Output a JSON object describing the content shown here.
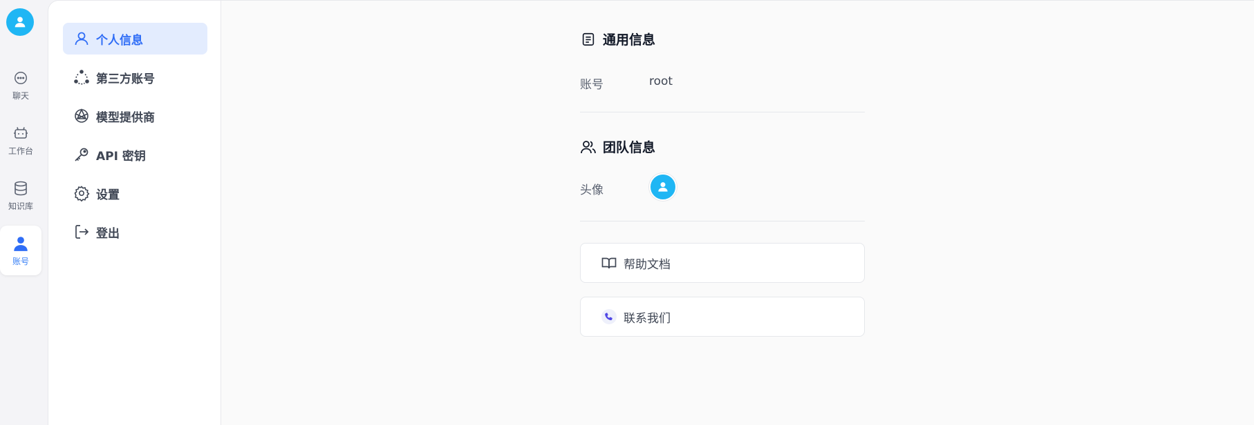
{
  "rail": {
    "avatar_icon": "user-icon",
    "items": [
      {
        "label": "聊天",
        "icon": "chat-bubble-icon"
      },
      {
        "label": "工作台",
        "icon": "robot-icon"
      },
      {
        "label": "知识库",
        "icon": "database-icon"
      },
      {
        "label": "账号",
        "icon": "user-icon",
        "active": true
      }
    ]
  },
  "menu": {
    "items": [
      {
        "label": "个人信息",
        "icon": "user-outline-icon",
        "active": true
      },
      {
        "label": "第三方账号",
        "icon": "connections-icon"
      },
      {
        "label": "模型提供商",
        "icon": "model-provider-icon"
      },
      {
        "label": "API 密钥",
        "icon": "key-icon"
      },
      {
        "label": "设置",
        "icon": "gear-icon"
      },
      {
        "label": "登出",
        "icon": "logout-icon"
      }
    ]
  },
  "general": {
    "title": "通用信息",
    "icon": "document-icon",
    "account_label": "账号",
    "account_value": "root"
  },
  "team": {
    "title": "团队信息",
    "icon": "users-icon",
    "avatar_label": "头像"
  },
  "links": {
    "help": {
      "label": "帮助文档",
      "icon": "book-icon"
    },
    "contact": {
      "label": "联系我们",
      "icon": "phone-icon"
    }
  },
  "colors": {
    "accent": "#2f6df6",
    "avatar_bg": "#1fb6f4",
    "active_menu_bg": "#e3ecfe"
  }
}
